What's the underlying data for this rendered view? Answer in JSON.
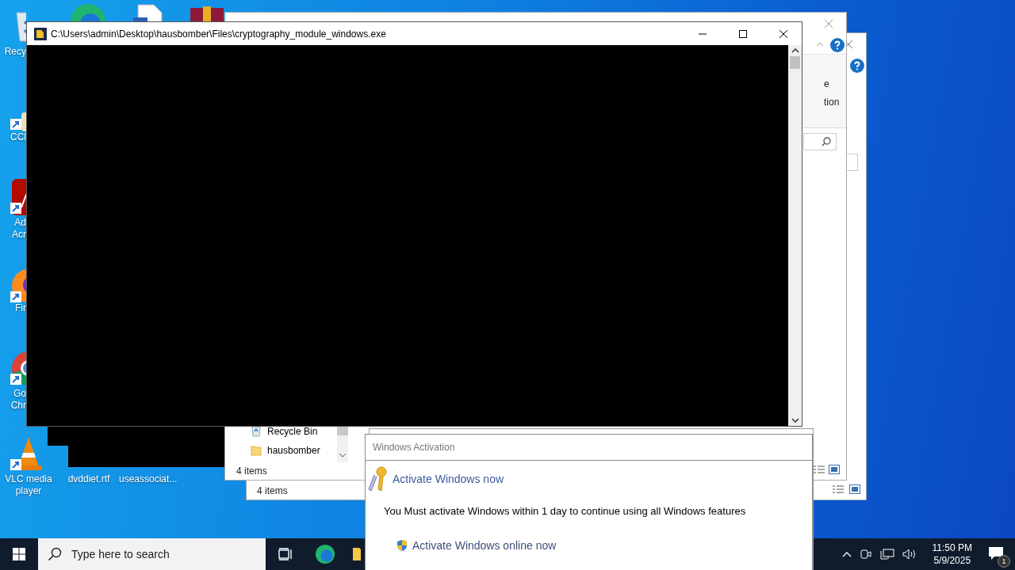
{
  "desktop_icons": [
    {
      "kind": "recycle",
      "lines": [
        "Recy"
      ]
    },
    {
      "kind": "ccleaner",
      "lines": [
        "CCl"
      ]
    },
    {
      "kind": "acrobat",
      "lines": [
        "Ad",
        "Acr"
      ]
    },
    {
      "kind": "firefox",
      "lines": [
        "Fir"
      ]
    },
    {
      "kind": "chrome",
      "lines": [
        "Go",
        "Chr"
      ]
    },
    {
      "kind": "vlc",
      "lines": [
        "VLC media",
        "player"
      ]
    },
    {
      "kind": "hidden",
      "lines": [
        "dvddiet.rtf"
      ]
    },
    {
      "kind": "hidden",
      "lines": [
        "useassociat..."
      ]
    },
    {
      "kind": "edge"
    },
    {
      "kind": "document"
    },
    {
      "kind": "archive"
    }
  ],
  "explorer_back": {
    "status": "4 items"
  },
  "explorer_front": {
    "ribbon_texts": [
      "e",
      "tion"
    ],
    "nav_items": [
      {
        "kind": "recycle",
        "label": "Recycle Bin"
      },
      {
        "kind": "folder",
        "label": "hausbomber"
      }
    ],
    "status": "4 items"
  },
  "console_window": {
    "title": "C:\\Users\\admin\\Desktop\\hausbomber\\Files\\cryptography_module_windows.exe"
  },
  "activation": {
    "title": "Windows Activation",
    "heading": "Activate Windows now",
    "message": "You Must activate Windows within 1 day to continue using all Windows features",
    "option": "Activate Windows online now"
  },
  "taskbar": {
    "search_placeholder": "Type here to search",
    "time": "11:50 PM",
    "date": "5/9/2025",
    "notification_count": "1"
  }
}
